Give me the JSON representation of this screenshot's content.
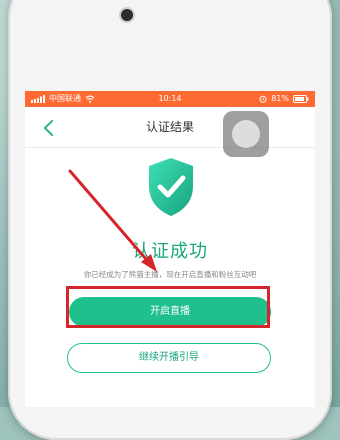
{
  "status_bar": {
    "carrier": "中国联通",
    "time": "10:14",
    "battery": "81%"
  },
  "nav": {
    "title": "认证结果"
  },
  "result": {
    "title": "认证成功",
    "description": "你已经成为了熊猫主播，现在开启直播和粉丝互动吧"
  },
  "buttons": {
    "primary": "开启直播",
    "secondary": "继续开播引导"
  },
  "colors": {
    "status_bar": "#ff6a32",
    "accent": "#1fbf8e",
    "highlight": "#d6252a"
  }
}
